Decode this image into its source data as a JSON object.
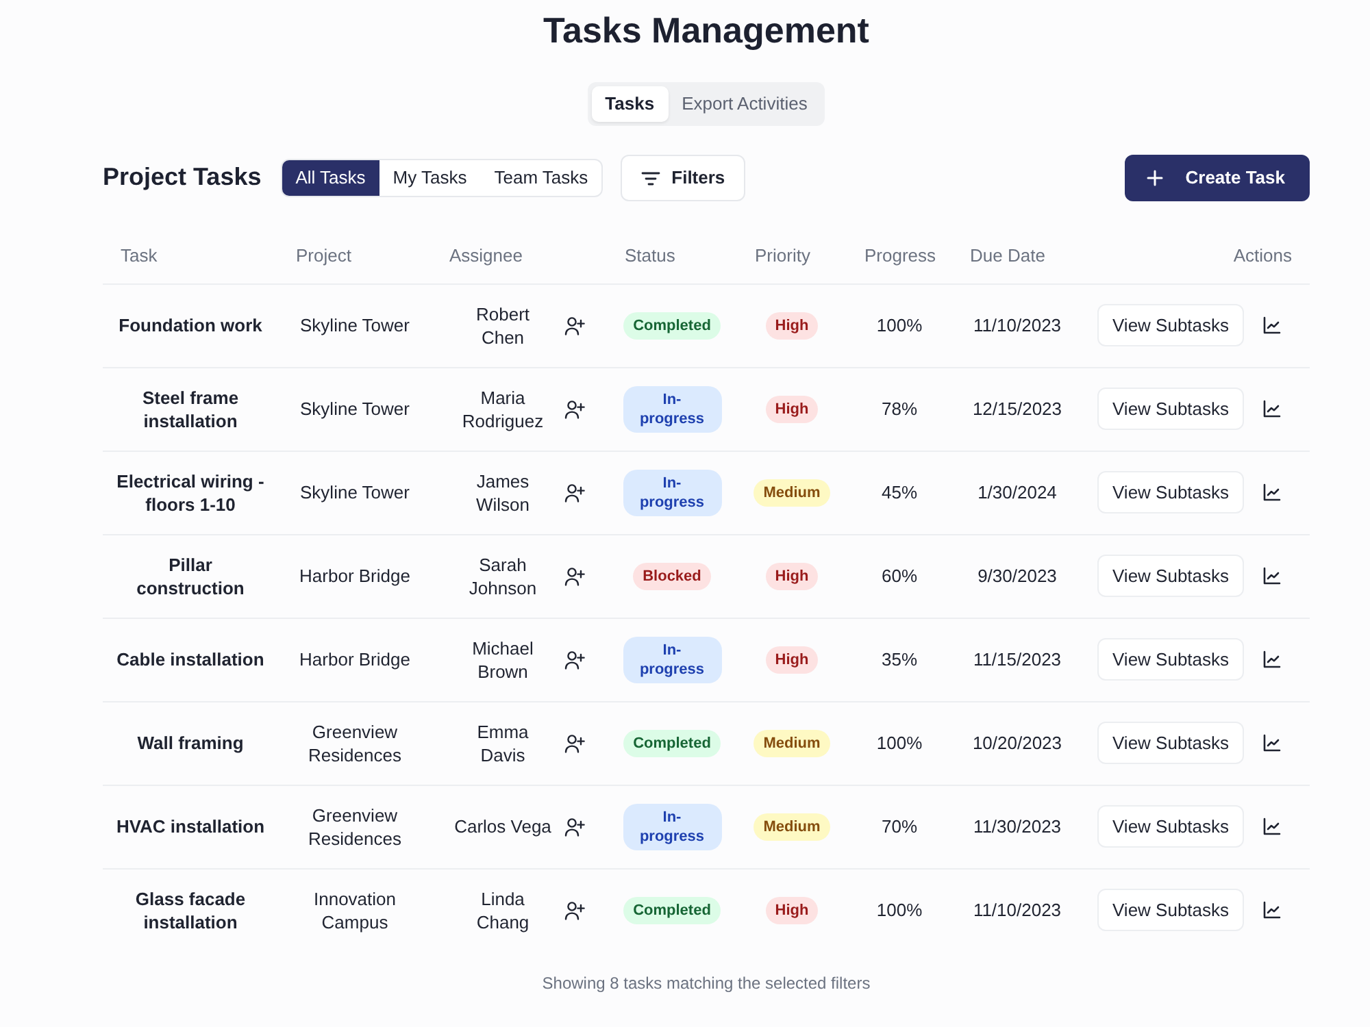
{
  "header": {
    "title": "Tasks Management"
  },
  "view_tabs": [
    {
      "label": "Tasks",
      "selected": true
    },
    {
      "label": "Export Activities",
      "selected": false
    }
  ],
  "toolbar": {
    "title": "Project Tasks",
    "scope_tabs": [
      {
        "label": "All Tasks",
        "selected": true
      },
      {
        "label": "My Tasks",
        "selected": false
      },
      {
        "label": "Team Tasks",
        "selected": false
      }
    ],
    "filters_button": "Filters",
    "create_button": "Create Task"
  },
  "table": {
    "columns": [
      "Task",
      "Project",
      "Assignee",
      "Status",
      "Priority",
      "Progress",
      "Due Date",
      "Actions"
    ],
    "rows": [
      {
        "task": "Foundation work",
        "project": "Skyline Tower",
        "assignee": "Robert Chen",
        "status": {
          "text": "Completed",
          "kind": "completed"
        },
        "priority": {
          "text": "High",
          "kind": "high"
        },
        "progress": "100%",
        "due_date": "11/10/2023",
        "action": "View Subtasks"
      },
      {
        "task": "Steel frame installation",
        "project": "Skyline Tower",
        "assignee": "Maria Rodriguez",
        "status": {
          "text": "In-progress",
          "kind": "in_progress"
        },
        "priority": {
          "text": "High",
          "kind": "high"
        },
        "progress": "78%",
        "due_date": "12/15/2023",
        "action": "View Subtasks"
      },
      {
        "task": "Electrical wiring - floors 1-10",
        "project": "Skyline Tower",
        "assignee": "James Wilson",
        "status": {
          "text": "In-progress",
          "kind": "in_progress"
        },
        "priority": {
          "text": "Medium",
          "kind": "medium"
        },
        "progress": "45%",
        "due_date": "1/30/2024",
        "action": "View Subtasks"
      },
      {
        "task": "Pillar construction",
        "project": "Harbor Bridge",
        "assignee": "Sarah Johnson",
        "status": {
          "text": "Blocked",
          "kind": "blocked"
        },
        "priority": {
          "text": "High",
          "kind": "high"
        },
        "progress": "60%",
        "due_date": "9/30/2023",
        "action": "View Subtasks"
      },
      {
        "task": "Cable installation",
        "project": "Harbor Bridge",
        "assignee": "Michael Brown",
        "status": {
          "text": "In-progress",
          "kind": "in_progress"
        },
        "priority": {
          "text": "High",
          "kind": "high"
        },
        "progress": "35%",
        "due_date": "11/15/2023",
        "action": "View Subtasks"
      },
      {
        "task": "Wall framing",
        "project": "Greenview Residences",
        "assignee": "Emma Davis",
        "status": {
          "text": "Completed",
          "kind": "completed"
        },
        "priority": {
          "text": "Medium",
          "kind": "medium"
        },
        "progress": "100%",
        "due_date": "10/20/2023",
        "action": "View Subtasks"
      },
      {
        "task": "HVAC installation",
        "project": "Greenview Residences",
        "assignee": "Carlos Vega",
        "status": {
          "text": "In-progress",
          "kind": "in_progress"
        },
        "priority": {
          "text": "Medium",
          "kind": "medium"
        },
        "progress": "70%",
        "due_date": "11/30/2023",
        "action": "View Subtasks"
      },
      {
        "task": "Glass facade installation",
        "project": "Innovation Campus",
        "assignee": "Linda Chang",
        "status": {
          "text": "Completed",
          "kind": "completed"
        },
        "priority": {
          "text": "High",
          "kind": "high"
        },
        "progress": "100%",
        "due_date": "11/10/2023",
        "action": "View Subtasks"
      }
    ]
  },
  "footer": {
    "summary": "Showing 8 tasks matching the selected filters"
  }
}
